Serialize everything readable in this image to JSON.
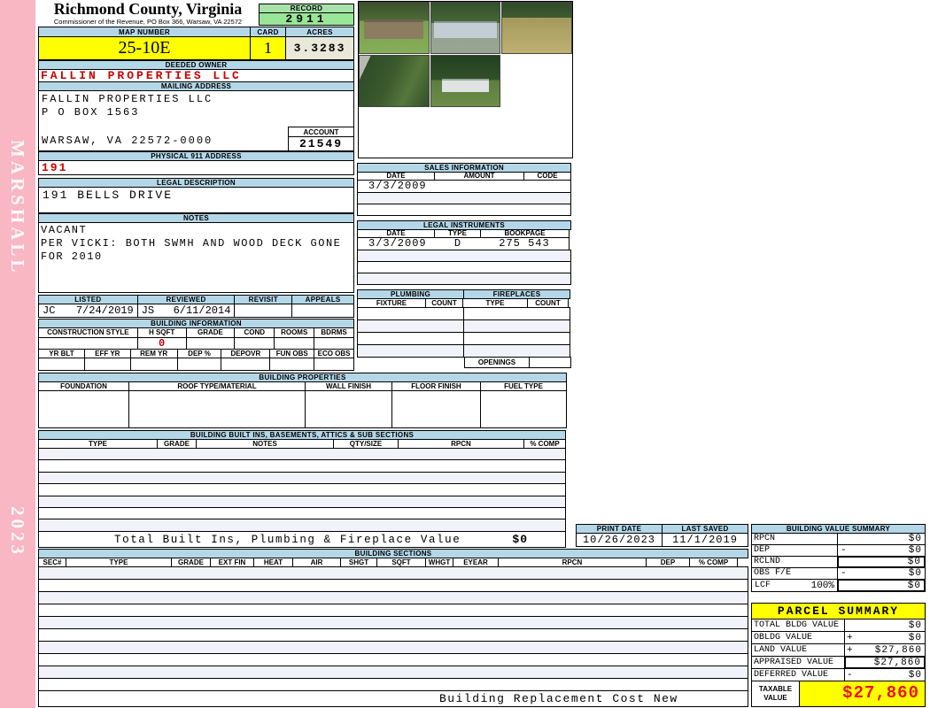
{
  "sidebar": {
    "vendor": "MARSHALL",
    "year": "2023"
  },
  "header": {
    "county": "Richmond County, Virginia",
    "commissioner_line": "Commissioner of the Revenue, PO Box 366, Warsaw, VA 22572",
    "record_label": "RECORD",
    "record_number": "2911"
  },
  "map_row": {
    "map_number_label": "MAP NUMBER",
    "map_number": "25-10E",
    "card_label": "CARD",
    "card": "1",
    "acres_label": "ACRES",
    "acres": "3.3283"
  },
  "owner": {
    "deeded_owner_label": "DEEDED OWNER",
    "deeded_owner": "FALLIN PROPERTIES LLC",
    "mailing_address_label": "MAILING ADDRESS",
    "mailing_lines": [
      "FALLIN PROPERTIES LLC",
      "P O BOX 1563",
      "WARSAW, VA 22572-0000"
    ],
    "account_label": "ACCOUNT",
    "account_number": "21549"
  },
  "location": {
    "physical_911_label": "PHYSICAL 911 ADDRESS",
    "physical_911": "191",
    "legal_description_label": "LEGAL DESCRIPTION",
    "legal_description": "191 BELLS DRIVE",
    "notes_label": "NOTES",
    "notes_lines": [
      "VACANT",
      "PER VICKI: BOTH SWMH AND WOOD DECK GONE",
      "FOR 2010"
    ]
  },
  "review": {
    "listed_label": "LISTED",
    "listed_by": "JC",
    "listed_date": "7/24/2019",
    "reviewed_label": "REVIEWED",
    "reviewed_by": "JS",
    "reviewed_date": "6/11/2014",
    "revisit_label": "REVISIT",
    "appeals_label": "APPEALS"
  },
  "building_information": {
    "title": "BUILDING INFORMATION",
    "row1_headers": [
      "CONSTRUCTION STYLE",
      "H SQFT",
      "GRADE",
      "COND",
      "ROOMS",
      "BDRMS"
    ],
    "h_sqft": "0",
    "row2_headers": [
      "YR BLT",
      "EFF YR",
      "REM YR",
      "DEP %",
      "DEPOVR",
      "FUN OBS",
      "ECO OBS"
    ]
  },
  "sales_information": {
    "title": "SALES INFORMATION",
    "headers": [
      "DATE",
      "AMOUNT",
      "CODE"
    ],
    "row1_date": "3/3/2009"
  },
  "legal_instruments": {
    "title": "LEGAL INSTRUMENTS",
    "headers": [
      "DATE",
      "TYPE",
      "BOOKPAGE"
    ],
    "row1": {
      "date": "3/3/2009",
      "type": "D",
      "book_page": "275 543"
    }
  },
  "plumbing_fireplaces": {
    "plumbing_title": "PLUMBING",
    "fireplaces_title": "FIREPLACES",
    "plumbing_headers": [
      "FIXTURE",
      "COUNT"
    ],
    "fireplace_headers": [
      "TYPE",
      "COUNT"
    ],
    "openings_label": "OPENINGS"
  },
  "building_properties": {
    "title": "BUILDING PROPERTIES",
    "headers": [
      "FOUNDATION",
      "ROOF TYPE/MATERIAL",
      "WALL FINISH",
      "FLOOR FINISH",
      "FUEL TYPE"
    ]
  },
  "built_ins": {
    "title": "BUILDING BUILT INS, BASEMENTS, ATTICS & SUB SECTIONS",
    "headers": [
      "TYPE",
      "GRADE",
      "NOTES",
      "QTY/SIZE",
      "RPCN",
      "% COMP"
    ],
    "total_label": "Total Built Ins, Plumbing & Fireplace Value",
    "total_value": "$0"
  },
  "dates": {
    "print_date_label": "PRINT DATE",
    "print_date": "10/26/2023",
    "last_saved_label": "LAST SAVED",
    "last_saved": "11/1/2019"
  },
  "building_value_summary": {
    "title": "BUILDING VALUE SUMMARY",
    "rows": [
      {
        "label": "RPCN",
        "op": "",
        "value": "$0"
      },
      {
        "label": "DEP",
        "op": "-",
        "value": "$0"
      },
      {
        "label": "RCLND",
        "op": "",
        "value": "$0"
      },
      {
        "label": "OBS F/E",
        "op": "-",
        "value": "$0"
      },
      {
        "label": "LCF",
        "pct": "100%",
        "op": "",
        "value": "$0"
      }
    ]
  },
  "building_sections": {
    "title": "BUILDING SECTIONS",
    "headers": [
      "SEC#",
      "TYPE",
      "GRADE",
      "EXT FIN",
      "HEAT",
      "AIR",
      "SHGT",
      "SQFT",
      "WHGT",
      "EYEAR",
      "RPCN",
      "DEP",
      "% COMP"
    ],
    "footer_note": "Building Replacement Cost New"
  },
  "parcel_summary": {
    "title": "PARCEL SUMMARY",
    "rows": [
      {
        "label": "TOTAL BLDG VALUE",
        "op": "",
        "value": "$0"
      },
      {
        "label": "OBLDG VALUE",
        "op": "+",
        "value": "$0"
      },
      {
        "label": "LAND VALUE",
        "op": "+",
        "value": "$27,860"
      },
      {
        "label": "APPRAISED VALUE",
        "op": "",
        "value": "$27,860"
      },
      {
        "label": "DEFERRED VALUE",
        "op": "-",
        "value": "$0"
      }
    ],
    "taxable_label_line1": "TAXABLE",
    "taxable_label_line2": "VALUE",
    "taxable_value": "$27,860"
  },
  "photos": {
    "captions": [
      "tan double-wide mobile home",
      "gray single-wide mobile home",
      "open field",
      "wooded lot",
      "white mobile home under trees"
    ]
  },
  "colors": {
    "header_blue": "#b4d7e8",
    "record_green": "#98e698",
    "highlight_yellow": "#ffff00",
    "acres_beige": "#e9e9d9",
    "sidebar_pink": "#f9b6c3",
    "alert_red": "#cc0000",
    "taxable_red": "#ee1111"
  }
}
